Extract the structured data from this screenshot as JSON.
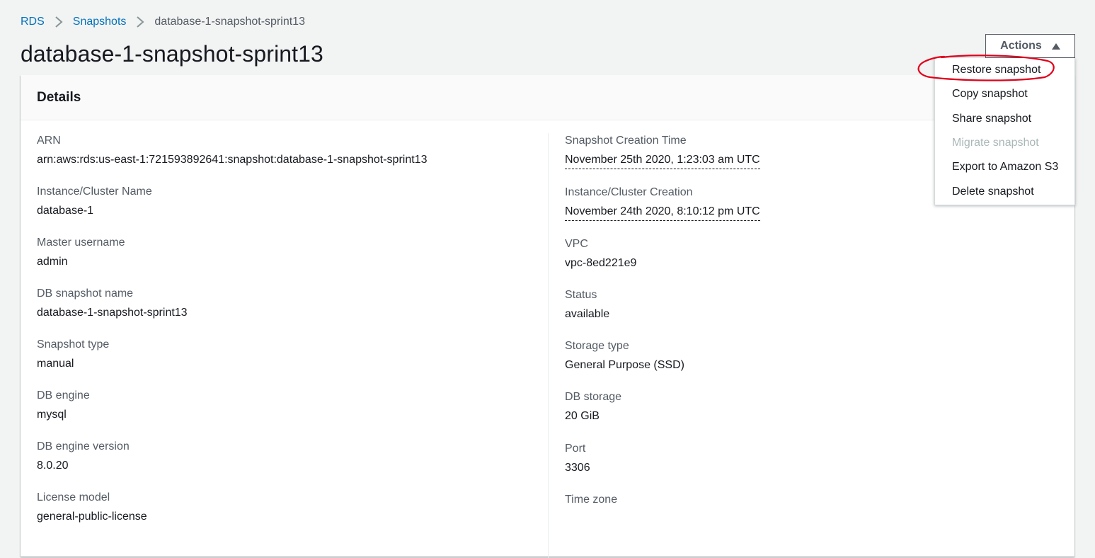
{
  "breadcrumb": {
    "items": [
      {
        "label": "RDS"
      },
      {
        "label": "Snapshots"
      },
      {
        "label": "database-1-snapshot-sprint13"
      }
    ],
    "separator_icon": "chevron-right-icon"
  },
  "page": {
    "title": "database-1-snapshot-sprint13"
  },
  "actions": {
    "label": "Actions",
    "caret_icon": "caret-up-icon",
    "menu": [
      {
        "label": "Restore snapshot",
        "enabled": true,
        "highlighted": true
      },
      {
        "label": "Copy snapshot",
        "enabled": true
      },
      {
        "label": "Share snapshot",
        "enabled": true
      },
      {
        "label": "Migrate snapshot",
        "enabled": false
      },
      {
        "label": "Export to Amazon S3",
        "enabled": true
      },
      {
        "label": "Delete snapshot",
        "enabled": true
      }
    ]
  },
  "details": {
    "title": "Details",
    "left": [
      {
        "label": "ARN",
        "value": "arn:aws:rds:us-east-1:721593892641:snapshot:database-1-snapshot-sprint13"
      },
      {
        "label": "Instance/Cluster Name",
        "value": "database-1"
      },
      {
        "label": "Master username",
        "value": "admin"
      },
      {
        "label": "DB snapshot name",
        "value": "database-1-snapshot-sprint13"
      },
      {
        "label": "Snapshot type",
        "value": "manual"
      },
      {
        "label": "DB engine",
        "value": "mysql"
      },
      {
        "label": "DB engine version",
        "value": "8.0.20"
      },
      {
        "label": "License model",
        "value": "general-public-license"
      }
    ],
    "right": [
      {
        "label": "Snapshot Creation Time",
        "value": "November 25th 2020, 1:23:03 am UTC"
      },
      {
        "label": "Instance/Cluster Creation",
        "value": "November 24th 2020, 8:10:12 pm UTC"
      },
      {
        "label": "VPC",
        "value": "vpc-8ed221e9"
      },
      {
        "label": "Status",
        "value": "available"
      },
      {
        "label": "Storage type",
        "value": "General Purpose (SSD)"
      },
      {
        "label": "DB storage",
        "value": "20 GiB"
      },
      {
        "label": "Port",
        "value": "3306"
      },
      {
        "label": "Time zone",
        "value": ""
      }
    ]
  },
  "colors": {
    "link": "#0073bb",
    "annotation": "#e0001a",
    "disabled": "#aab7b8",
    "background": "#f2f3f3"
  }
}
